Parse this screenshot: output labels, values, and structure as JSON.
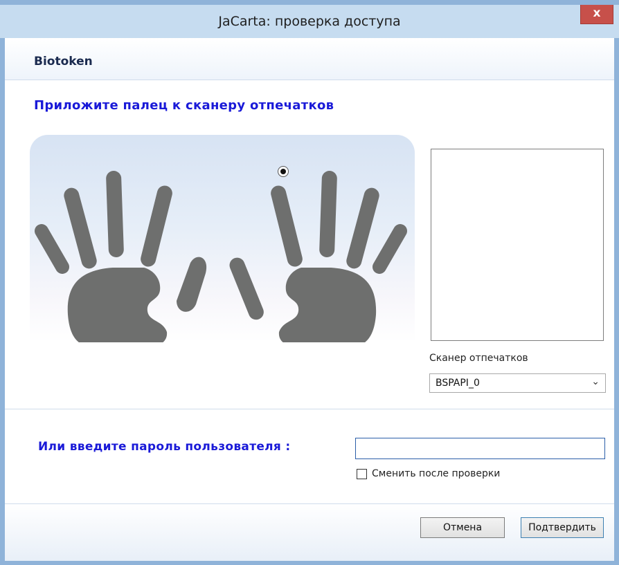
{
  "window": {
    "title": "JaCarta: проверка доступа",
    "close_label": "x"
  },
  "header": {
    "title": "Biotoken"
  },
  "fingerprint": {
    "instruction": "Приложите палец к сканеру отпечатков",
    "selected_finger": "left-hand-index"
  },
  "scanner": {
    "label": "Сканер отпечатков",
    "selected": "BSPAPI_0"
  },
  "password": {
    "label": "Или введите пароль пользователя :",
    "value": "",
    "change_after_check_label": "Сменить после проверки",
    "change_after_check": false
  },
  "buttons": {
    "cancel": "Отмена",
    "confirm": "Подтвердить"
  },
  "colors": {
    "title_bar": "#c6dcf0",
    "window_border": "#8fb3d9",
    "close_button": "#c7504a",
    "accent_text": "#1a1ad8",
    "hand": "#6e6f6e"
  },
  "icons": {
    "close": "close-icon",
    "dropdown": "chevron-down-icon",
    "hands": "hands-icon"
  }
}
